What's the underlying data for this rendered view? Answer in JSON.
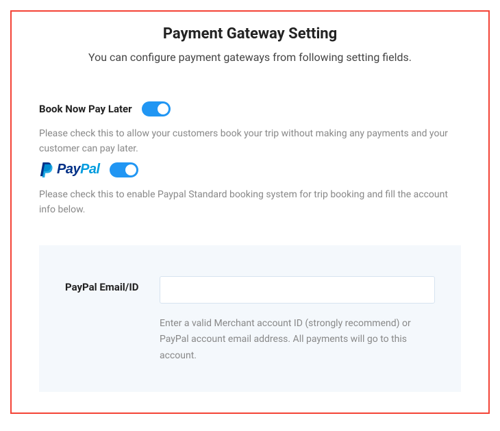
{
  "title": "Payment Gateway Setting",
  "subtitle": "You can configure payment gateways from following setting fields.",
  "bookNowPayLater": {
    "label": "Book Now Pay Later",
    "hint": "Please check this to allow your customers book your trip without making any payments and your customer can pay later.",
    "enabled": true
  },
  "paypal": {
    "brand_dark": "Pay",
    "brand_light": "Pal",
    "hint": "Please check this to enable Paypal Standard booking system for trip booking and fill the account info below.",
    "enabled": true,
    "emailField": {
      "label": "PayPal Email/ID",
      "value": "",
      "hint": "Enter a valid Merchant account ID (strongly recommend) or PayPal account email address. All payments will go to this account."
    }
  }
}
